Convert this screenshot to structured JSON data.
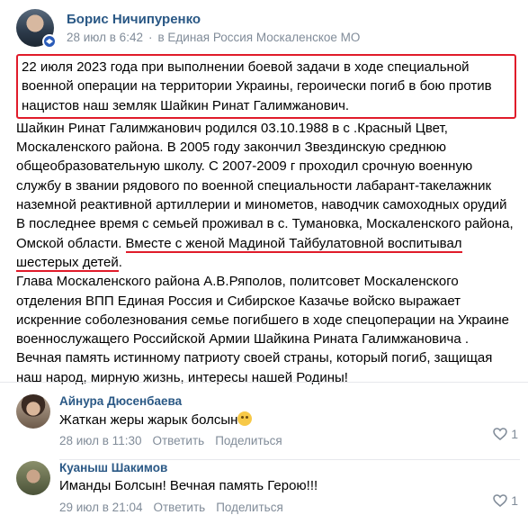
{
  "post": {
    "author": "Борис Ничипуренко",
    "date": "28 июл в 6:42",
    "community": "в Единая Россия Москаленское МО",
    "highlighted_paragraph": "22 июля 2023 года при выполнении боевой задачи в ходе специальной военной операции на территории Украины, героически погиб в бою против нацистов наш земляк Шайкин Ринат Галимжанович.",
    "paragraph_bio": "Шайкин Ринат Галимжанович родился 03.10.1988 в с .Красный Цвет, Москаленского района. В 2005 году закончил Звездинскую среднюю общеобразовательную школу. С 2007-2009 г проходил срочную военную службу в звании рядового по военной специальности лабарант-такелажник наземной реактивной артиллерии и минометов, наводчик самоходных орудий",
    "paragraph_family_start": "В последнее время с семьей проживал в с. Тумановка, Москаленского района, Омской области. ",
    "paragraph_family_underlined": "Вместе с женой Мадиной Тайбулатовной воспитывал шестерых детей",
    "paragraph_family_end": ".",
    "paragraph_condolence": "Глава Москаленского района А.В.Ряполов, политсовет Москаленского отделения ВПП Единая Россия и Сибирское Казачье войско выражает искренние соболезнования семье погибшего в ходе спецоперации на Украине военнослужащего Российской Армии Шайкина Рината Галимжановича . Вечная память истинному патриоту своей страны, который погиб, защищая наш народ, мирную жизнь, интересы нашей Родины!"
  },
  "comments": [
    {
      "author": "Айнура Дюсенбаева",
      "text": "Жаткан жеры жарык болсын",
      "emoji": "crying-face",
      "date": "28 июл в 11:30",
      "reply_label": "Ответить",
      "share_label": "Поделиться",
      "likes": "1"
    },
    {
      "author": "Куаныш Шакимов",
      "text": "Иманды Болсын! Вечная память Герою!!!",
      "date": "29 июл в 21:04",
      "reply_label": "Ответить",
      "share_label": "Поделиться",
      "likes": "1"
    }
  ],
  "colors": {
    "link": "#2a5885",
    "meta": "#818c99",
    "highlight": "#e01b2a"
  }
}
